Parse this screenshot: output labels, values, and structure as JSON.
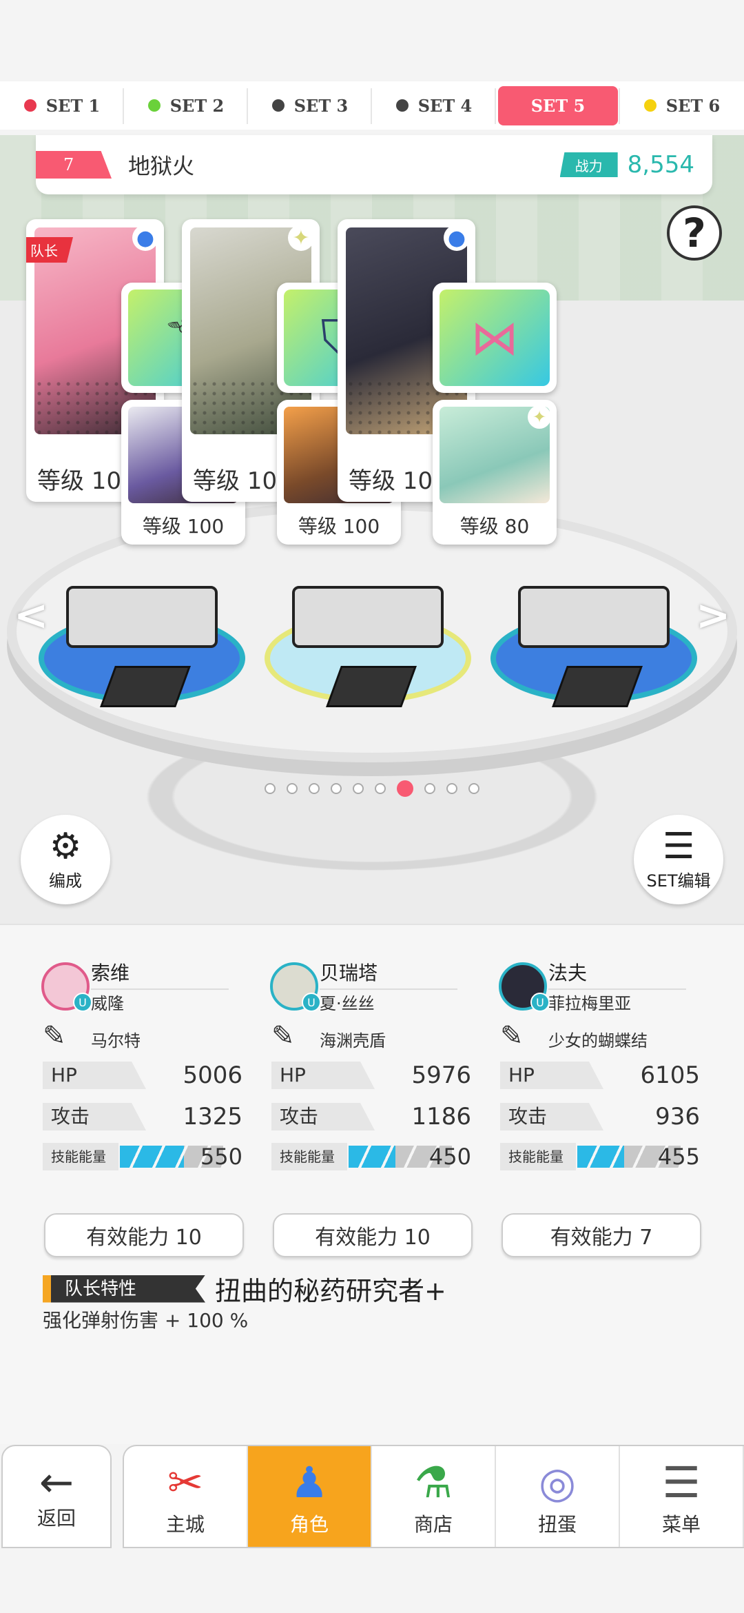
{
  "sets": [
    {
      "label": "SET 1",
      "color": "#e8384f",
      "active": false
    },
    {
      "label": "SET 2",
      "color": "#6ad13a",
      "active": false
    },
    {
      "label": "SET 3",
      "color": "#444444",
      "active": false
    },
    {
      "label": "SET 4",
      "color": "#444444",
      "active": false
    },
    {
      "label": "SET 5",
      "color": "#f85a72",
      "active": true
    },
    {
      "label": "SET 6",
      "color": "#f5d10f",
      "active": false
    }
  ],
  "team": {
    "number": "7",
    "name": "地狱火",
    "power_label": "战力",
    "power_value": "8,554"
  },
  "help": "?",
  "cards": [
    {
      "leader_tag": "队长",
      "level": "等级 100",
      "sub_level": "等级 100"
    },
    {
      "level": "等级 100",
      "sub_level": "等级 100"
    },
    {
      "level": "等级 100",
      "sub_level": "等级 80"
    }
  ],
  "arrows": {
    "left": "<",
    "right": ">"
  },
  "buttons": {
    "formation": "编成",
    "set_edit": "SET编辑"
  },
  "characters": [
    {
      "name": "索维",
      "sub": "威隆",
      "weapon": "马尔特",
      "hp_label": "HP",
      "hp": "5006",
      "atk_label": "攻击",
      "atk": "1325",
      "energy_label": "技能能量",
      "energy": "550",
      "energy_fill": 0.62,
      "ability": "有效能力 10"
    },
    {
      "name": "贝瑞塔",
      "sub": "夏·丝丝",
      "weapon": "海渊壳盾",
      "hp_label": "HP",
      "hp": "5976",
      "atk_label": "攻击",
      "atk": "1186",
      "energy_label": "技能能量",
      "energy": "450",
      "energy_fill": 0.45,
      "ability": "有效能力 10"
    },
    {
      "name": "法夫",
      "sub": "菲拉梅里亚",
      "weapon": "少女的蝴蝶结",
      "hp_label": "HP",
      "hp": "6105",
      "atk_label": "攻击",
      "atk": "936",
      "energy_label": "技能能量",
      "energy": "455",
      "energy_fill": 0.45,
      "ability": "有效能力 7"
    }
  ],
  "leader_trait": {
    "tag": "队长特性",
    "name": "扭曲的秘药研究者+",
    "desc": "强化弹射伤害 + 100 %"
  },
  "nav": {
    "back": "返回",
    "tabs": [
      "主城",
      "角色",
      "商店",
      "扭蛋",
      "菜单"
    ]
  }
}
